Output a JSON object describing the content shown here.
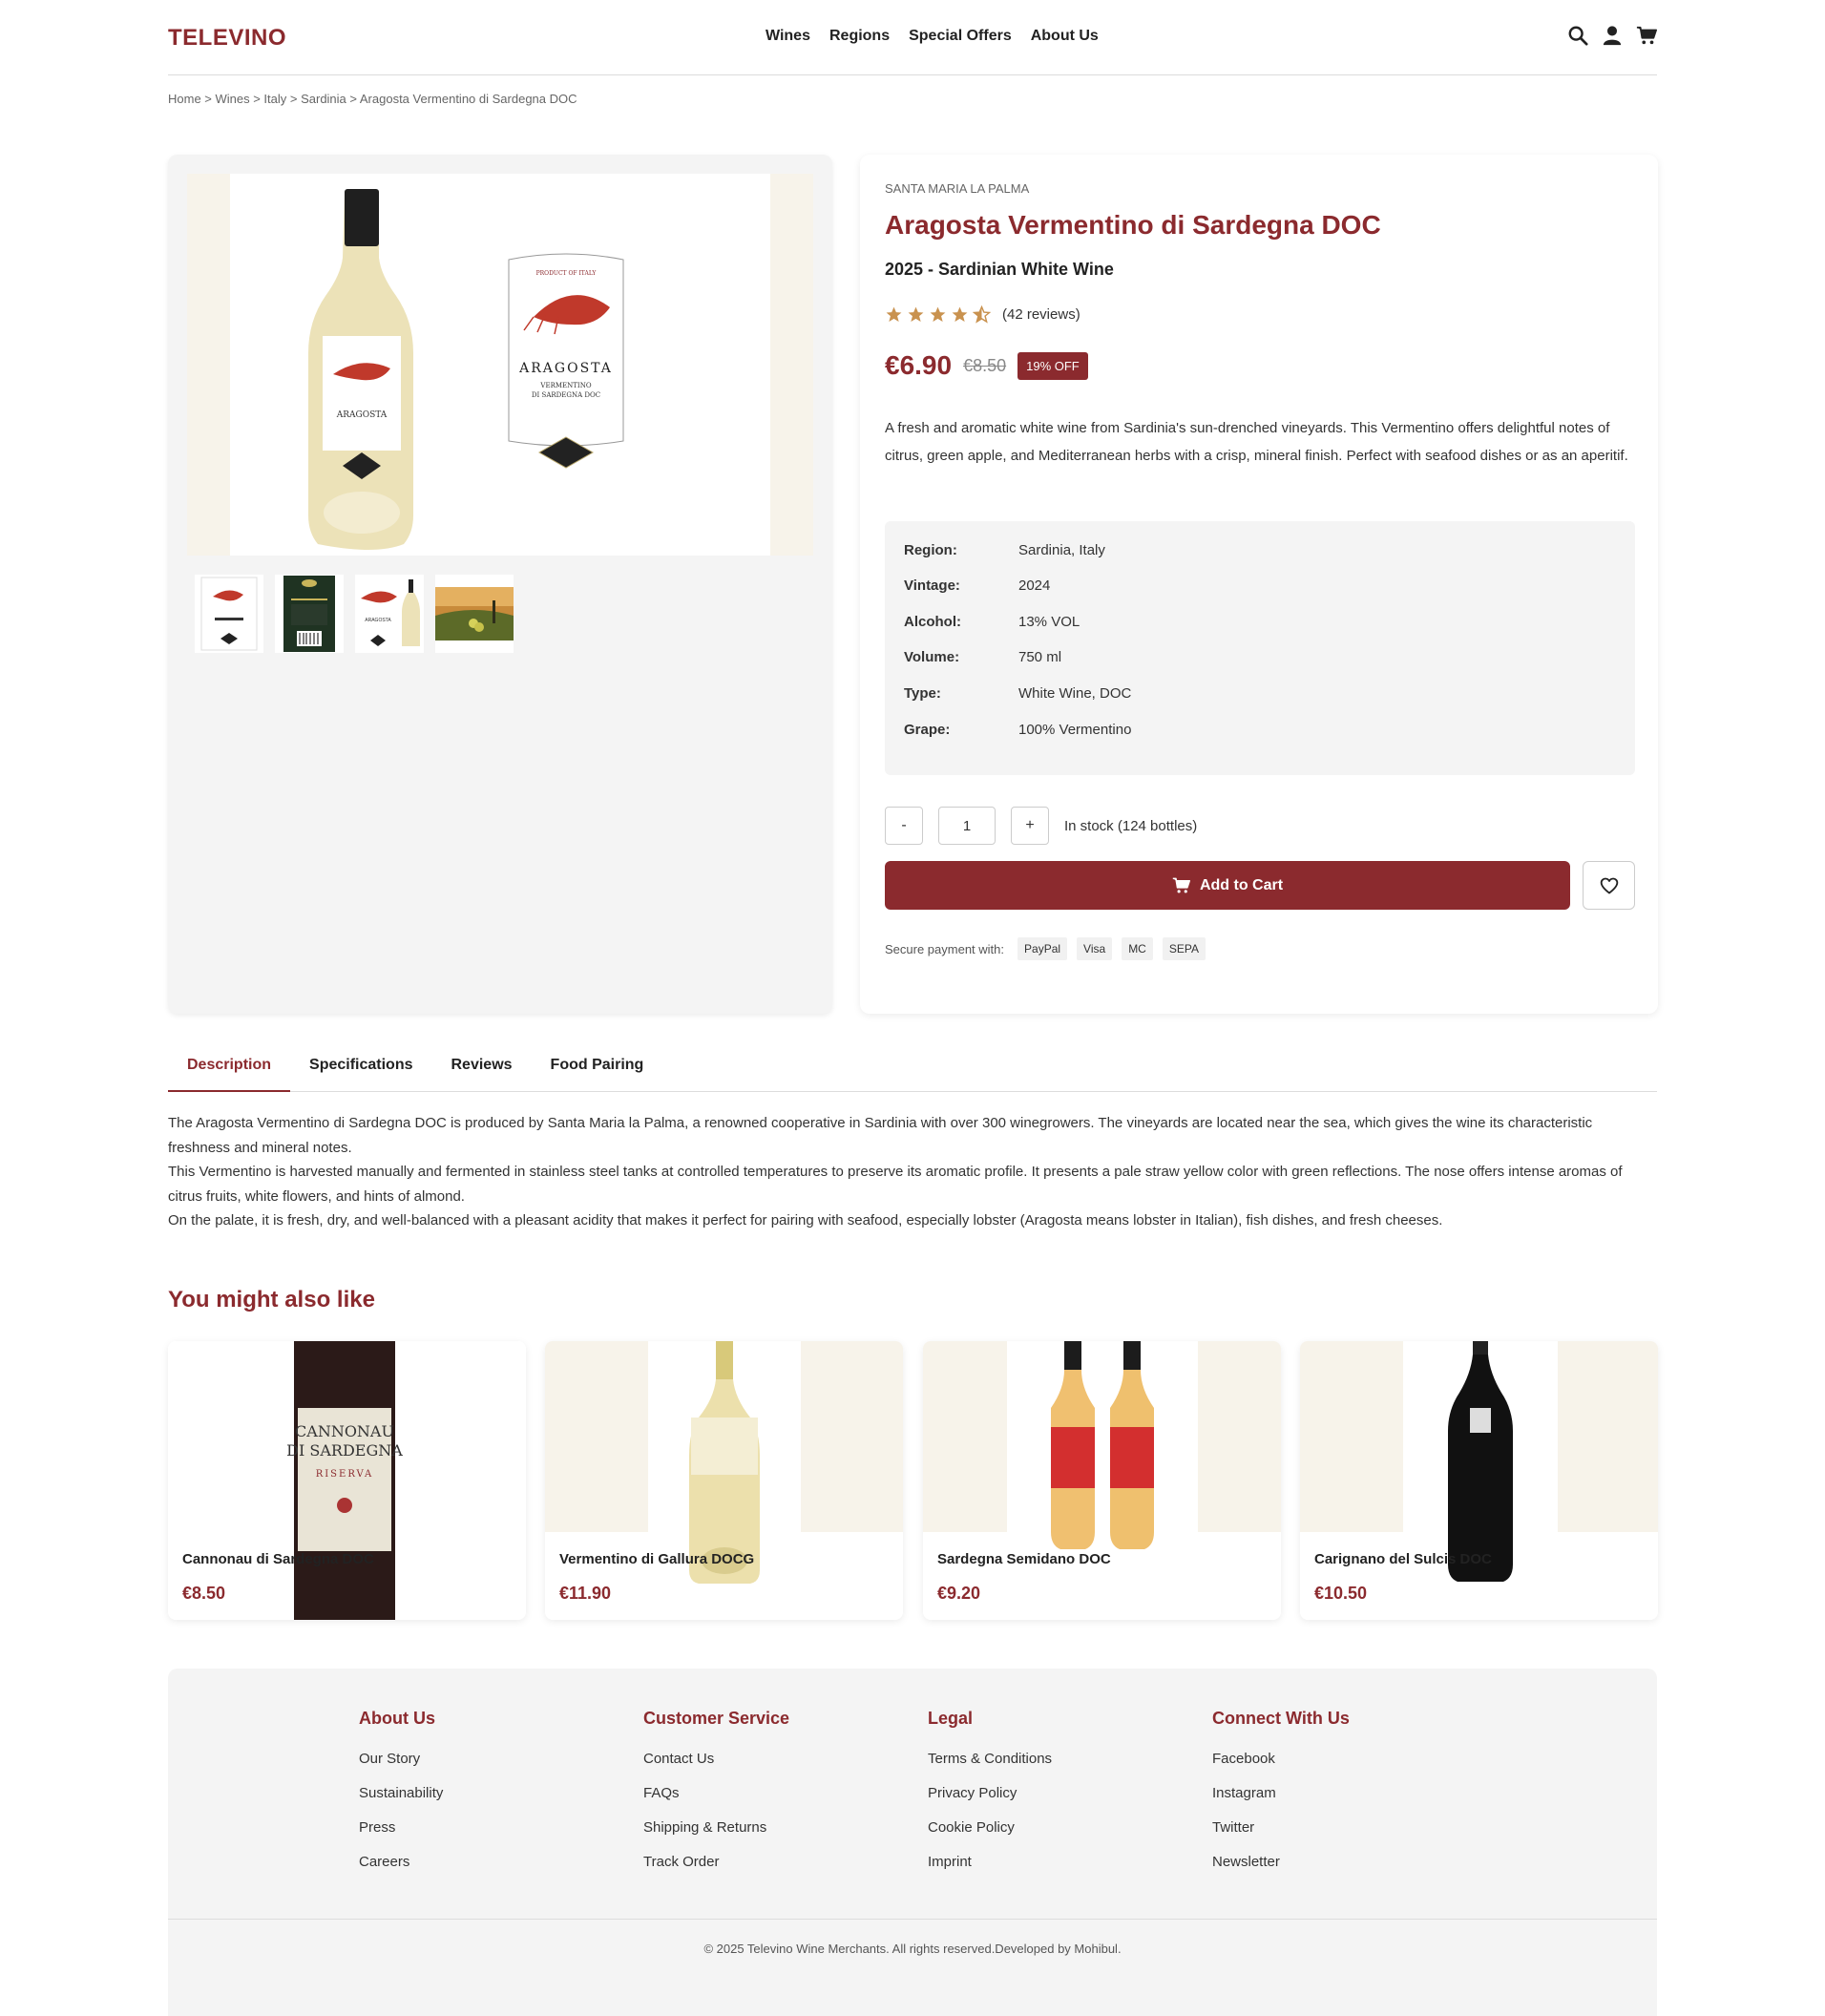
{
  "header": {
    "logo": "TELEVINO",
    "nav": [
      "Wines",
      "Regions",
      "Special Offers",
      "About Us"
    ],
    "icons": [
      "search-icon",
      "user-icon",
      "cart-icon"
    ]
  },
  "breadcrumb": "Home > Wines > Italy > Sardinia > Aragosta Vermentino di Sardegna DOC",
  "product": {
    "producer": "SANTA MARIA LA PALMA",
    "title": "Aragosta Vermentino di Sardegna DOC",
    "subtitle": "2025 - Sardinian White Wine",
    "rating": 4.5,
    "reviews": "(42 reviews)",
    "price": "€6.90",
    "old_price": "€8.50",
    "discount": "19% OFF",
    "description": "A fresh and aromatic white wine from Sardinia's sun-drenched vineyards. This Vermentino offers delightful notes of citrus, green apple, and Mediterranean herbs with a crisp, mineral finish. Perfect with seafood dishes or as an aperitif.",
    "specs": [
      {
        "label": "Region:",
        "value": "Sardinia, Italy"
      },
      {
        "label": "Vintage:",
        "value": "2024"
      },
      {
        "label": "Alcohol:",
        "value": "13% VOL"
      },
      {
        "label": "Volume:",
        "value": "750 ml"
      },
      {
        "label": "Type:",
        "value": "White Wine, DOC"
      },
      {
        "label": "Grape:",
        "value": "100% Vermentino"
      }
    ],
    "quantity": {
      "minus": "-",
      "value": "1",
      "plus": "+"
    },
    "stock": "In stock (124 bottles)",
    "add_to_cart": "Add to Cart",
    "payment_label": "Secure payment with:",
    "payment_methods": [
      "PayPal",
      "Visa",
      "MC",
      "SEPA"
    ]
  },
  "tabs": [
    "Description",
    "Specifications",
    "Reviews",
    "Food Pairing"
  ],
  "long_description": [
    "The Aragosta Vermentino di Sardegna DOC is produced by Santa Maria la Palma, a renowned cooperative in Sardinia with over 300 winegrowers. The vineyards are located near the sea, which gives the wine its characteristic freshness and mineral notes.",
    "This Vermentino is harvested manually and fermented in stainless steel tanks at controlled temperatures to preserve its aromatic profile. It presents a pale straw yellow color with green reflections. The nose offers intense aromas of citrus fruits, white flowers, and hints of almond.",
    "On the palate, it is fresh, dry, and well-balanced with a pleasant acidity that makes it perfect for pairing with seafood, especially lobster (Aragosta means lobster in Italian), fish dishes, and fresh cheeses."
  ],
  "recommendations": {
    "title": "You might also like",
    "items": [
      {
        "name": "Cannonau di Sardegna DOC",
        "price": "€8.50"
      },
      {
        "name": "Vermentino di Gallura DOCG",
        "price": "€11.90"
      },
      {
        "name": "Sardegna Semidano DOC",
        "price": "€9.20"
      },
      {
        "name": "Carignano del Sulcis DOC",
        "price": "€10.50"
      }
    ]
  },
  "footer": {
    "columns": [
      {
        "title": "About Us",
        "links": [
          "Our Story",
          "Sustainability",
          "Press",
          "Careers"
        ]
      },
      {
        "title": "Customer Service",
        "links": [
          "Contact Us",
          "FAQs",
          "Shipping & Returns",
          "Track Order"
        ]
      },
      {
        "title": "Legal",
        "links": [
          "Terms & Conditions",
          "Privacy Policy",
          "Cookie Policy",
          "Imprint"
        ]
      },
      {
        "title": "Connect With Us",
        "links": [
          "Facebook",
          "Instagram",
          "Twitter",
          "Newsletter"
        ]
      }
    ],
    "copyright": "© 2025 Televino Wine Merchants. All rights reserved.Developed by Mohibul."
  },
  "colors": {
    "brand": "#8b2a2e",
    "star": "#c9924f",
    "panel": "#f4f4f4",
    "cream": "#f7f3ea"
  }
}
